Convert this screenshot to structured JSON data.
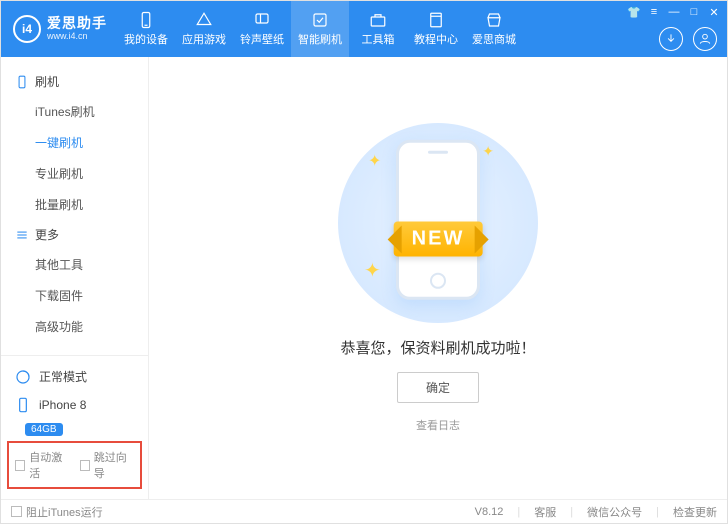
{
  "brand": {
    "title": "爱思助手",
    "url": "www.i4.cn",
    "logo_text": "i4"
  },
  "nav": {
    "items": [
      {
        "label": "我的设备",
        "icon": "device"
      },
      {
        "label": "应用游戏",
        "icon": "apps"
      },
      {
        "label": "铃声壁纸",
        "icon": "music"
      },
      {
        "label": "智能刷机",
        "icon": "flash",
        "active": true
      },
      {
        "label": "工具箱",
        "icon": "toolbox"
      },
      {
        "label": "教程中心",
        "icon": "book"
      },
      {
        "label": "爱思商城",
        "icon": "shop"
      }
    ]
  },
  "sidebar": {
    "groups": [
      {
        "title": "刷机",
        "icon": "phone",
        "items": [
          {
            "label": "iTunes刷机"
          },
          {
            "label": "一键刷机",
            "active": true
          },
          {
            "label": "专业刷机"
          },
          {
            "label": "批量刷机"
          }
        ]
      },
      {
        "title": "更多",
        "icon": "menu",
        "items": [
          {
            "label": "其他工具"
          },
          {
            "label": "下载固件"
          },
          {
            "label": "高级功能"
          }
        ]
      }
    ],
    "mode": {
      "label": "正常模式"
    },
    "device": {
      "name": "iPhone 8",
      "storage": "64GB"
    },
    "options": {
      "auto_activate": "自动激活",
      "skip_guide": "跳过向导"
    }
  },
  "main": {
    "ribbon": "NEW",
    "success": "恭喜您，保资料刷机成功啦！",
    "ok": "确定",
    "view_log": "查看日志"
  },
  "footer": {
    "block_itunes": "阻止iTunes运行",
    "version": "V8.12",
    "support": "客服",
    "wechat": "微信公众号",
    "check_update": "检查更新"
  }
}
